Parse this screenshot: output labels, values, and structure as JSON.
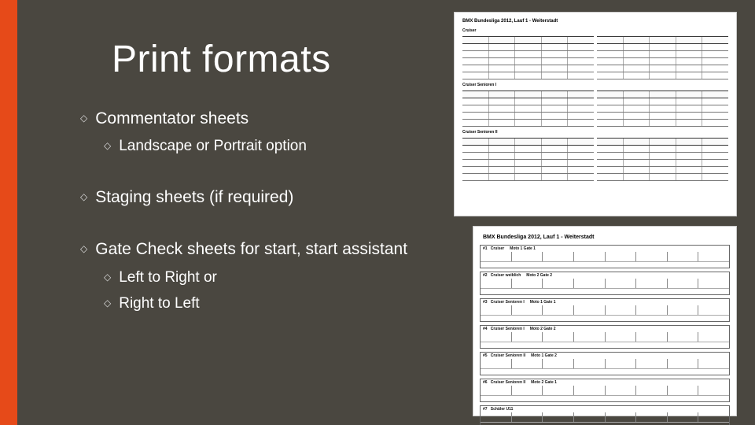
{
  "title": "Print formats",
  "bullets": {
    "b1": "Commentator sheets",
    "b1a": "Landscape or Portrait option",
    "b2": "Staging sheets (if required)",
    "b3": "Gate Check sheets for start, start assistant",
    "b3a": "Left to Right or",
    "b3b": "Right to Left"
  },
  "diamond": "◇",
  "thumb1_title": "BMX Bundesliga 2012, Lauf 1 - Weiterstadt",
  "thumb2_title": "BMX Bundesliga 2012, Lauf 1 - Weiterstadt"
}
